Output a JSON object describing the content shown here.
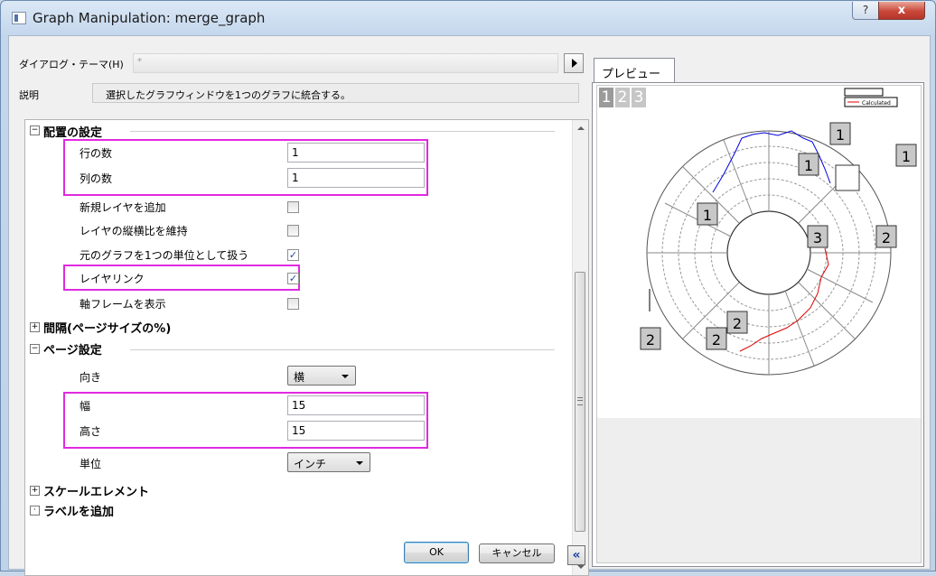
{
  "window": {
    "title": "Graph Manipulation: merge_graph",
    "help": "?",
    "close": "x"
  },
  "header": {
    "theme_label": "ダイアログ・テーマ(H)",
    "theme_value": "*",
    "desc_label": "説明",
    "desc_text": "選択したグラフウィンドウを1つのグラフに統合する。"
  },
  "tree": {
    "arrange_group": "配置の設定",
    "rows_label": "行の数",
    "rows_value": "1",
    "cols_label": "列の数",
    "cols_value": "1",
    "add_layer_label": "新規レイヤを追加",
    "keep_ratio_label": "レイヤの縦横比を維持",
    "treat_unit_label": "元のグラフを1つの単位として扱う",
    "layer_link_label": "レイヤリンク",
    "show_frame_label": "軸フレームを表示",
    "spacing_group": "間隔(ページサイズの%)",
    "page_group": "ページ設定",
    "orient_label": "向き",
    "orient_value": "横",
    "width_label": "幅",
    "width_value": "15",
    "height_label": "高さ",
    "height_value": "15",
    "unit_label": "単位",
    "unit_value": "インチ",
    "scale_group": "スケールエレメント",
    "add_label_group": "ラベルを追加",
    "checks": {
      "add_layer": false,
      "keep_ratio": false,
      "treat_unit": true,
      "layer_link": true,
      "show_frame": false
    }
  },
  "buttons": {
    "ok": "OK",
    "cancel": "キャンセル",
    "collapse": "«"
  },
  "preview": {
    "tab": "プレビュー",
    "pages": [
      "1",
      "2",
      "3"
    ],
    "layer_tags": [
      "1",
      "1",
      "1",
      "1",
      "3",
      "2",
      "2",
      "2",
      "2"
    ],
    "legend_calculated": "Calculated",
    "line_colors": {
      "blue": "#0000e0",
      "red": "#e00000"
    }
  }
}
